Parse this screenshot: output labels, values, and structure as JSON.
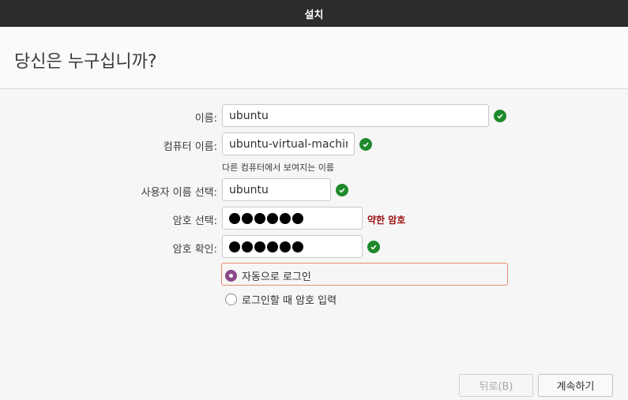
{
  "window": {
    "title": "설치"
  },
  "page": {
    "heading": "당신은 누구십니까?"
  },
  "form": {
    "name_label": "이름:",
    "name_value": "ubuntu",
    "computer_label": "컴퓨터 이름:",
    "computer_value": "ubuntu-virtual-machine",
    "computer_hint": "다른 컴퓨터에서 보여지는 이름",
    "username_label": "사용자 이름 선택:",
    "username_value": "ubuntu",
    "password_label": "암호 선택:",
    "password_strength": "약한 암호",
    "password_dot_count": 6,
    "confirm_label": "암호 확인:",
    "confirm_dot_count": 6
  },
  "login_options": {
    "auto_login_label": "자동으로 로그인",
    "require_password_label": "로그인할 때 암호 입력",
    "selected": "auto_login"
  },
  "buttons": {
    "back_label": "뒤로(B)",
    "continue_label": "계속하기"
  },
  "colors": {
    "valid_check": "#1e8a2b",
    "weak_password": "#9c0e0e",
    "radio_selected": "#8a4a89",
    "focus_border": "#e88d6a"
  },
  "icons": {
    "valid": "checkmark-circle-icon"
  }
}
